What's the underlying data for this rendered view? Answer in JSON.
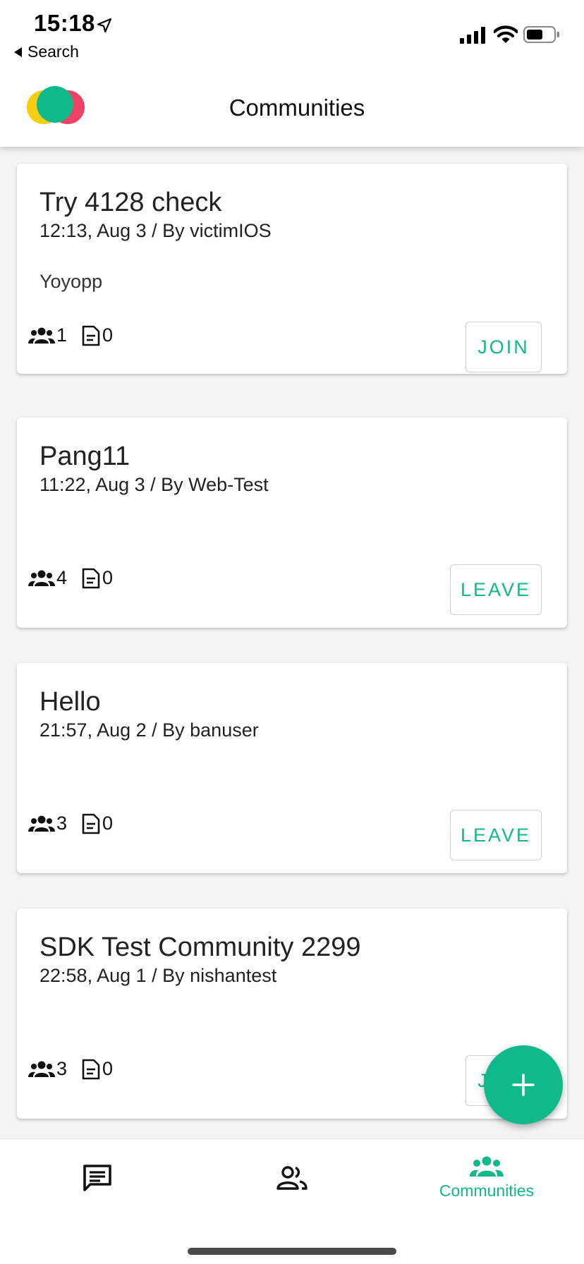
{
  "status_bar": {
    "time": "15:18",
    "back_label": "Search"
  },
  "header": {
    "title": "Communities"
  },
  "colors": {
    "accent": "#11b98a",
    "logo_yellow": "#f7cd12",
    "logo_green": "#11b98a",
    "logo_pink": "#ee4163"
  },
  "cards": [
    {
      "title": "Try 4128 check",
      "meta": "12:13, Aug 3 / By victimIOS",
      "description": "Yoyopp",
      "members": "1",
      "posts": "0",
      "button": "JOIN"
    },
    {
      "title": "Pang11",
      "meta": "11:22, Aug 3 / By Web-Test",
      "description": "",
      "members": "4",
      "posts": "0",
      "button": "LEAVE"
    },
    {
      "title": "Hello",
      "meta": "21:57, Aug 2 / By banuser",
      "description": "",
      "members": "3",
      "posts": "0",
      "button": "LEAVE"
    },
    {
      "title": "SDK Test Community 2299",
      "meta": "22:58, Aug 1 / By nishantest",
      "description": "",
      "members": "3",
      "posts": "0",
      "button": "JOIN"
    }
  ],
  "bottom_nav": {
    "chat_icon": "chat-icon",
    "people_icon": "people-icon",
    "communities_icon": "communities-icon",
    "communities_label": "Communities"
  },
  "fab": {
    "icon": "plus-icon"
  }
}
